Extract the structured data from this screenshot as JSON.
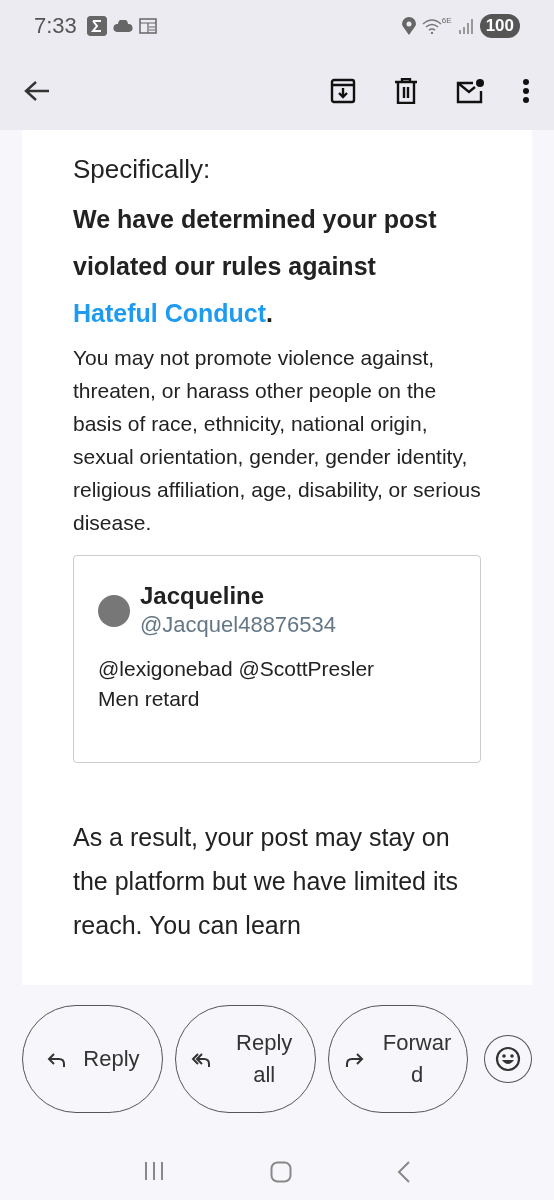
{
  "status_bar": {
    "time": "7:33",
    "network_label": "6E",
    "battery": "100"
  },
  "email": {
    "intro": "Specifically:",
    "heading": {
      "before": "We have determined your post violated our rules against ",
      "link": "Hateful Conduct",
      "after": "."
    },
    "policy": "You may not promote violence against, threaten, or harass other people on the basis of race, ethnicity, national origin, sexual orientation, gender, gender identity, religious affiliation, age, disability, or serious disease.",
    "post": {
      "name": "Jacqueline",
      "handle": "@Jacquel48876534",
      "text": "@lexigonebad @ScottPresler Men retard"
    },
    "result": "As a result, your post may stay on the platform but we have limited its reach. You can learn"
  },
  "actions": [
    {
      "kind": "reply",
      "label": "Reply"
    },
    {
      "kind": "reply_all",
      "label": "Reply all"
    },
    {
      "kind": "forward",
      "label": "Forward"
    }
  ]
}
